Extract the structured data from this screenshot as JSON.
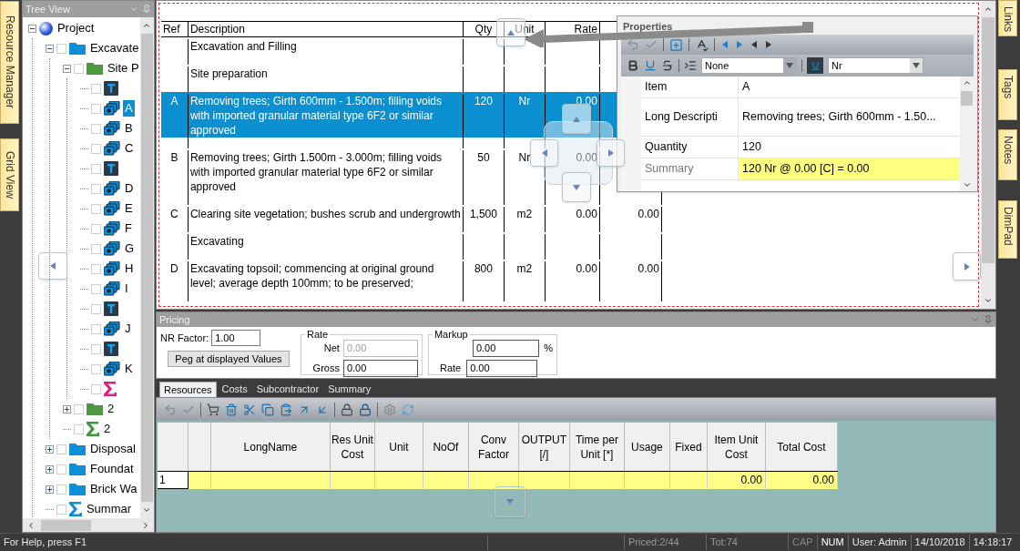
{
  "left_tabs": [
    {
      "label": "Resource Manager"
    },
    {
      "label": "Grid View"
    }
  ],
  "tree": {
    "title": "Tree View",
    "nodes": [
      {
        "label": "Project",
        "kind": "project",
        "expanded": true,
        "selected": false,
        "children": [
          {
            "label": "Excavate",
            "kind": "folder",
            "expanded": true,
            "checked": false,
            "selected": false,
            "children": [
              {
                "label": "Site P",
                "kind": "group",
                "expanded": true,
                "checked": false,
                "selected": false,
                "children": [
                  {
                    "kind": "text",
                    "checked": false,
                    "selected": false
                  },
                  {
                    "label": "A",
                    "kind": "item",
                    "checked": false,
                    "selected": true
                  },
                  {
                    "label": "B",
                    "kind": "item",
                    "checked": false,
                    "selected": false
                  },
                  {
                    "label": "C",
                    "kind": "item",
                    "checked": false,
                    "selected": false
                  },
                  {
                    "kind": "text",
                    "checked": false,
                    "selected": false
                  },
                  {
                    "label": "D",
                    "kind": "item",
                    "checked": false,
                    "selected": false
                  },
                  {
                    "label": "E",
                    "kind": "item",
                    "checked": false,
                    "selected": false
                  },
                  {
                    "label": "F",
                    "kind": "item",
                    "checked": false,
                    "selected": false
                  },
                  {
                    "label": "G",
                    "kind": "item",
                    "checked": false,
                    "selected": false
                  },
                  {
                    "label": "H",
                    "kind": "item",
                    "checked": false,
                    "selected": false
                  },
                  {
                    "label": "I",
                    "kind": "item",
                    "checked": false,
                    "selected": false
                  },
                  {
                    "kind": "text",
                    "checked": false,
                    "selected": false
                  },
                  {
                    "label": "J",
                    "kind": "item",
                    "checked": false,
                    "selected": false
                  },
                  {
                    "kind": "text",
                    "checked": false,
                    "selected": false
                  },
                  {
                    "label": "K",
                    "kind": "item",
                    "checked": false,
                    "selected": false
                  },
                  {
                    "kind": "sum",
                    "color": "#e0207a",
                    "checked": false,
                    "selected": false
                  }
                ]
              },
              {
                "label": "2",
                "kind": "group",
                "expanded": false,
                "checked": false,
                "selected": false
              },
              {
                "label": "2",
                "kind": "sum",
                "color": "#3a9a3a",
                "checked": false,
                "selected": false
              }
            ]
          },
          {
            "label": "Disposal",
            "kind": "folder",
            "expanded": false,
            "checked": false,
            "selected": false
          },
          {
            "label": "Foundat",
            "kind": "folder",
            "expanded": false,
            "checked": false,
            "selected": false
          },
          {
            "label": "Brick Wa",
            "kind": "folder",
            "expanded": false,
            "checked": false,
            "selected": false
          },
          {
            "label": "Summar",
            "kind": "sum",
            "color": "#0a8fd8",
            "checked": false,
            "selected": false
          }
        ]
      }
    ]
  },
  "document": {
    "columns": [
      "Ref",
      "Description",
      "Qty",
      "Unit",
      "Rate"
    ],
    "rows": [
      {
        "description": "Excavation and Filling"
      },
      {
        "description": "Site preparation"
      },
      {
        "ref": "A",
        "description": "Removing trees; Girth 600mm - 1.500m;  filling voids with imported granular material type 6F2 or similar approved",
        "qty": "120",
        "unit": "Nr",
        "rate": "0.00",
        "selected": true
      },
      {
        "ref": "B",
        "description": "Removing trees; Girth 1.500m - 3.000m; filling voids with imported granular material type 6F2 or similar approved",
        "qty": "50",
        "unit": "Nr",
        "rate": "0.00",
        "selected": false
      },
      {
        "ref": "C",
        "description": "Clearing site vegetation; bushes scrub and undergrowth",
        "qty": "1,500",
        "unit": "m2",
        "rate": "0.00",
        "column_6": "0.00",
        "selected": false
      },
      {
        "description": "Excavating"
      },
      {
        "ref": "D",
        "description": "Excavating topsoil; commencing at original ground level; average depth 100mm; to be preserved;",
        "qty": "800",
        "unit": "m2",
        "rate": "0.00",
        "column_6": "0.00",
        "selected": false
      }
    ]
  },
  "properties": {
    "title": "Properties",
    "style_select": "None",
    "unit_select": "Nr",
    "rows": [
      {
        "label": "Item",
        "value": "A",
        "readonly": false
      },
      {
        "label": "Long Descripti",
        "value": "Removing trees; Girth 600mm - 1.50...",
        "readonly": false
      },
      {
        "label": "Quantity",
        "value": "120",
        "readonly": false
      },
      {
        "label": "Summary",
        "value": "120 Nr @ 0.00 [C] = 0.00",
        "readonly": true
      }
    ]
  },
  "pricing": {
    "title": "Pricing",
    "nr_factor": {
      "label": "NR Factor:",
      "value": "1.00"
    },
    "peg_button": "Peg at displayed Values",
    "rate": {
      "title": "Rate",
      "fields": [
        {
          "label": "Net",
          "value": "0.00",
          "disabled": true
        },
        {
          "label": "Gross",
          "value": "0.00",
          "disabled": false
        }
      ]
    },
    "markup": {
      "title": "Markup",
      "percent": {
        "value": "0.00",
        "unit": "%"
      },
      "rate": {
        "label": "Rate",
        "value": "0.00"
      }
    }
  },
  "resource_tabs": [
    {
      "label": "Resources",
      "selected": true
    },
    {
      "label": "Costs",
      "selected": false
    },
    {
      "label": "Subcontractor",
      "selected": false
    },
    {
      "label": "Summary",
      "selected": false
    }
  ],
  "resources": {
    "columns": [
      "LongName",
      "Res Unit Cost",
      "Unit",
      "NoOf",
      "Conv Factor",
      "OUTPUT [/]",
      "Time per Unit [*]",
      "Usage",
      "Fixed",
      "Item Unit Cost",
      "Total Cost"
    ],
    "rows": [
      {
        "number": "1",
        "cells": [
          null,
          null,
          null,
          null,
          null,
          null,
          null,
          null,
          null,
          "0.00",
          "0.00"
        ]
      }
    ]
  },
  "right_tabs": [
    {
      "label": "Links"
    },
    {
      "label": "Tags"
    },
    {
      "label": "Notes"
    },
    {
      "label": "DimPad"
    }
  ],
  "status_bar": {
    "help": "For Help, press F1",
    "priced": "Priced:2/44",
    "total": "Tot:74",
    "indicators": [
      {
        "label": "CAP",
        "on": false
      },
      {
        "label": "NUM",
        "on": true
      }
    ],
    "user": "User: Admin",
    "date": "14/10/2018",
    "time": "14:18:17"
  }
}
